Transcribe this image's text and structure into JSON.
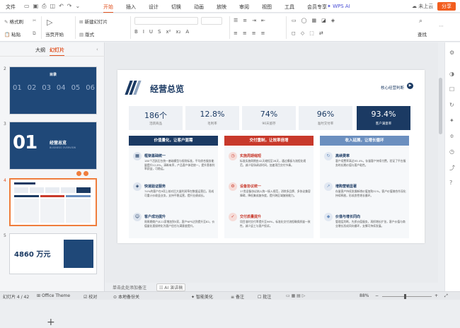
{
  "titlebar": {
    "file": "文件",
    "menu": [
      "开始",
      "插入",
      "设计",
      "切换",
      "动画",
      "放映",
      "审阅",
      "视图",
      "工具",
      "会员专享"
    ],
    "wps_ai": "WPS AI",
    "cloud": "未上云",
    "share": "分享"
  },
  "ribbon": {
    "format_painter": "格式刷",
    "paste": "粘贴",
    "start_page": "当页开始",
    "new_slide": "新建幻灯片",
    "layout": "版式",
    "find": "查找"
  },
  "left_pane": {
    "tab_outline": "大纲",
    "tab_slides": "幻灯片",
    "thumbs": [
      {
        "num": "2",
        "title": "目录",
        "items": [
          "01",
          "02",
          "03",
          "04",
          "05",
          "06"
        ]
      },
      {
        "num": "3",
        "big": "01",
        "title": "经营总览",
        "sub": "BUSINESS OVERVIEW"
      },
      {
        "num": "4"
      },
      {
        "num": "5",
        "value": "4860 万元"
      }
    ]
  },
  "slide": {
    "title": "经营总览",
    "link": "核心经营判断",
    "kpis": [
      {
        "value": "186个",
        "label": "活跃商品"
      },
      {
        "value": "12.8%",
        "label": "毛利率"
      },
      {
        "value": "74%",
        "label": "90天留存"
      },
      {
        "value": "96%",
        "label": "准时交付率"
      },
      {
        "value": "93.4%",
        "label": "客户满意率"
      }
    ],
    "columns": [
      {
        "head": "价值量化，让客户驱需",
        "items": [
          {
            "h": "框架基础统一",
            "t": "180个活跃后台统一基础模型与规则标准，平均综合服务能量提升12.8%，清晰有序，产品客户体验统一，提升营收利率获益，可稳运。"
          },
          {
            "h": "快速验证服务",
            "t": "74%的客户在9项上核对后大量利润率在数据运营后，形成可重计价收益业务，支持平稳运营，提升业绩成长。"
          },
          {
            "h": "客户成功提升",
            "t": "周周期商户从11家增加到5家，客户NPS达到提升至82，价值量化直接转化为客户信任与满意度提升。"
          }
        ]
      },
      {
        "head": "交付重制，让效率倍增",
        "items": [
          {
            "h": "实施周期缩短",
            "t": "标准实施周期由42天缩短至28天，通过模板与流程化规范，减少现场调试时间，加速项目交付节奏。"
          },
          {
            "h": "设备协议统一",
            "t": "17类设备协议纳入统一接入规范，消除多品牌、多协议兼容障碍，降低集成复杂度，提升跨区域复制能力。"
          },
          {
            "h": "交付质量提升",
            "t": "项目准时交付率提升至96%，标准化交付流程确保质量一致性，减少返工与客户投诉。"
          }
        ]
      },
      {
        "head": "收入延展，让增长循环",
        "items": [
          {
            "h": "高续费率",
            "t": "客户续费率高达93.4%，存量客户持续付费，验证了平台服务的长期价值与客户粘性。"
          },
          {
            "h": "增购营销显著",
            "t": "存量客户持续发掘新增价值加购31%，客户价值随合作深化持续释放，形成良性增长循环。"
          },
          {
            "h": "价值与增长同向",
            "t": "管理层判断，先抓价值服务，再抓增长扩张，客户价值与商业增长形成同向循环，支撑可持续发展。"
          }
        ]
      }
    ]
  },
  "notes": "单击此处添加备注",
  "ai_button": "AI 演讲稿",
  "status": {
    "slide": "幻灯片 4 / 42",
    "theme": "Office Theme",
    "proof": "校对",
    "font_missing": "本地备份关",
    "smart": "智能美化",
    "notes": "备注",
    "comment": "批注",
    "zoom": "88%"
  },
  "colors": {
    "navy": "#1b3a63",
    "red": "#c8392b",
    "blue": "#6b8fbf",
    "accent": "#e0501e"
  }
}
